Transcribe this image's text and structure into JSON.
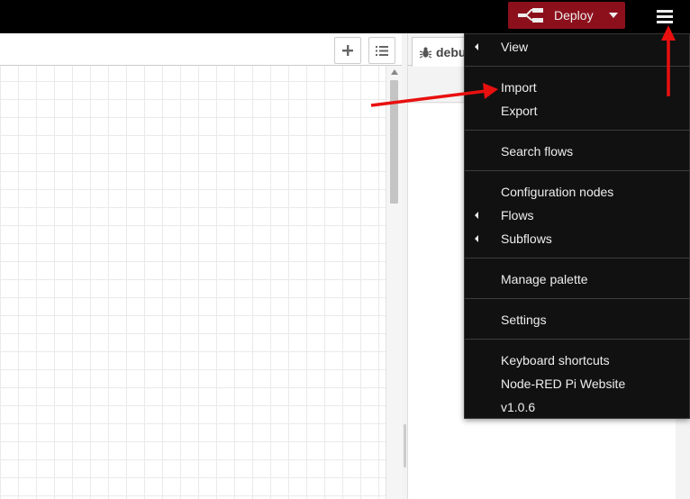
{
  "header": {
    "deploy_label": "Deploy",
    "accent_color": "#8c101c"
  },
  "workspace": {
    "add_tab_icon": "plus-icon",
    "list_tabs_icon": "list-icon"
  },
  "sidebar": {
    "tab_label": "debu",
    "tab_icon": "bug-icon"
  },
  "menu": {
    "items": [
      {
        "label": "View",
        "submenu": true
      },
      {
        "label": "Import",
        "submenu": false
      },
      {
        "label": "Export",
        "submenu": false
      },
      {
        "label": "Search flows",
        "submenu": false
      },
      {
        "label": "Configuration nodes",
        "submenu": false
      },
      {
        "label": "Flows",
        "submenu": true
      },
      {
        "label": "Subflows",
        "submenu": true
      },
      {
        "label": "Manage palette",
        "submenu": false
      },
      {
        "label": "Settings",
        "submenu": false
      },
      {
        "label": "Keyboard shortcuts",
        "submenu": false
      },
      {
        "label": "Node-RED Pi Website",
        "submenu": false
      },
      {
        "label": "v1.0.6",
        "submenu": false
      }
    ]
  },
  "annotations": {
    "arrow_color": "#e8100f"
  }
}
